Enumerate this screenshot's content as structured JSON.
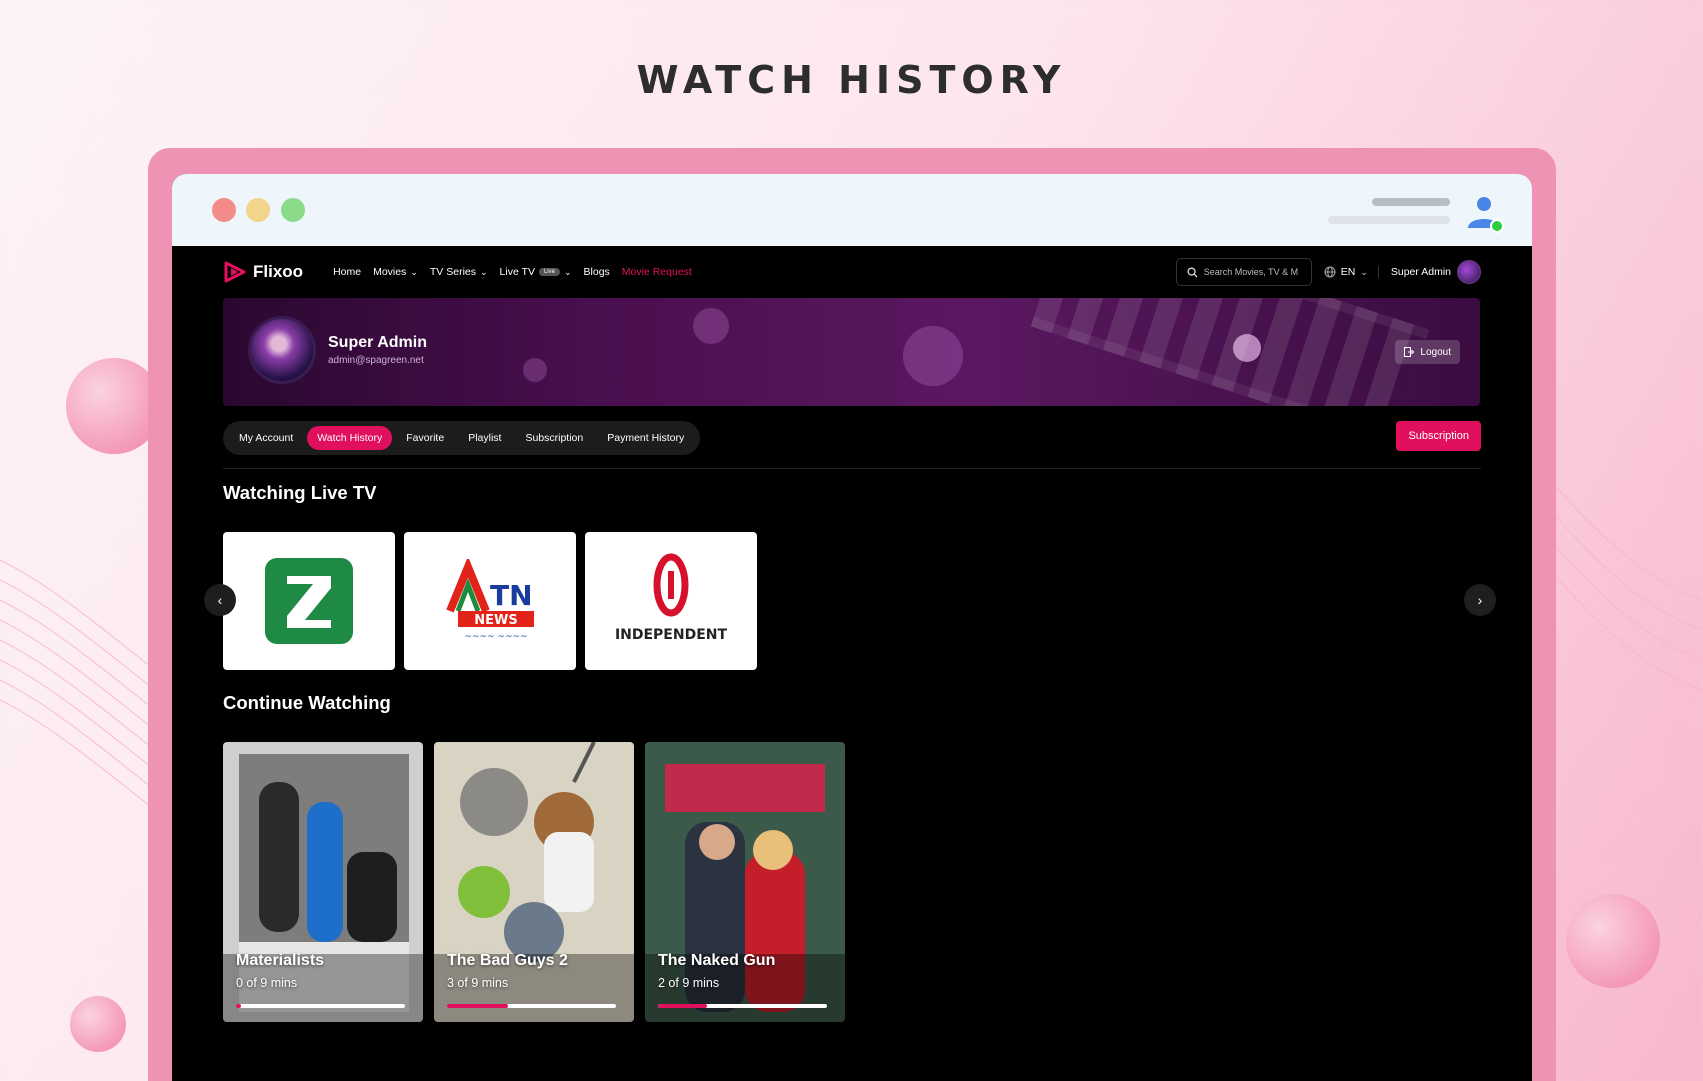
{
  "page_heading": "WATCH HISTORY",
  "colors": {
    "accent": "#e0105e",
    "frame": "#ee93b3",
    "window_bg": "#000000"
  },
  "app": {
    "logo_text": "Flixoo",
    "nav": {
      "home": "Home",
      "movies": "Movies",
      "tv_series": "TV Series",
      "live_tv": "Live TV",
      "live_badge": "Live",
      "blogs": "Blogs",
      "movie_request": "Movie Request"
    },
    "search_placeholder": "Search Movies, TV & M",
    "language": "EN",
    "user_name": "Super Admin"
  },
  "profile": {
    "name": "Super Admin",
    "email": "admin@spagreen.net",
    "logout_label": "Logout"
  },
  "tabs": [
    {
      "label": "My Account",
      "active": false
    },
    {
      "label": "Watch History",
      "active": true
    },
    {
      "label": "Favorite",
      "active": false
    },
    {
      "label": "Playlist",
      "active": false
    },
    {
      "label": "Subscription",
      "active": false
    },
    {
      "label": "Payment History",
      "active": false
    }
  ],
  "subscription_button": "Subscription",
  "live_tv_section": {
    "title": "Watching Live TV",
    "channels": [
      {
        "name": "Z",
        "logo": "z-channel-logo"
      },
      {
        "name": "ATN NEWS",
        "logo": "atn-news-logo"
      },
      {
        "name": "INDEPENDENT",
        "logo": "independent-logo"
      }
    ]
  },
  "continue_section": {
    "title": "Continue Watching",
    "items": [
      {
        "title": "Materialists",
        "progress_text": "0 of 9 mins",
        "progress": 0.03
      },
      {
        "title": "The Bad Guys 2",
        "progress_text": "3 of 9 mins",
        "progress": 0.36
      },
      {
        "title": "The Naked Gun",
        "progress_text": "2 of 9 mins",
        "progress": 0.29
      }
    ]
  }
}
